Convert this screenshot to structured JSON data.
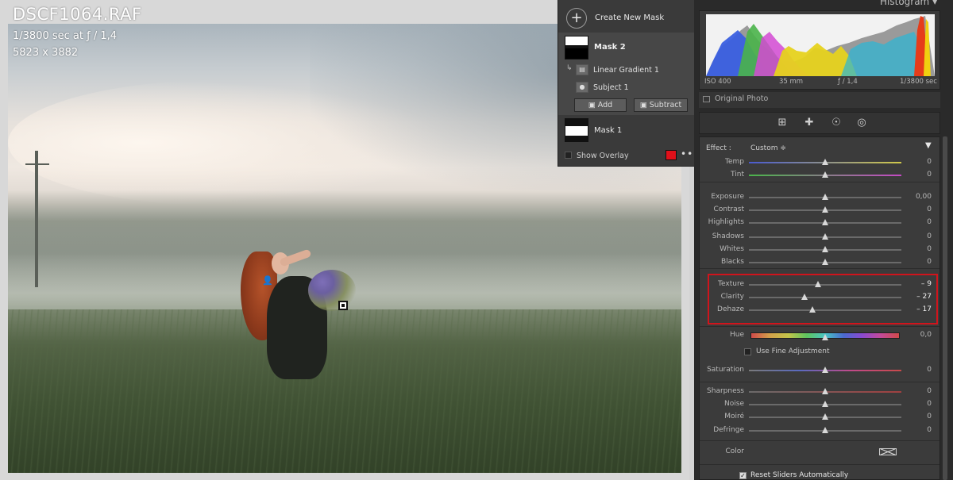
{
  "photo_info": {
    "filename": "DSCF1064.RAF",
    "exposure": "1/3800 sec at ƒ / 1,4",
    "dimensions": "5823 x 3882"
  },
  "mask_panel": {
    "create_label": "Create New Mask",
    "mask2_label": "Mask 2",
    "sub_items": [
      {
        "label": "Linear Gradient 1",
        "icon": "gradient-icon"
      },
      {
        "label": "Subject 1",
        "icon": "person-icon"
      }
    ],
    "add_label": "Add",
    "subtract_label": "Subtract",
    "mask1_label": "Mask 1",
    "show_overlay_label": "Show Overlay",
    "overlay_color": "#e0101a"
  },
  "histogram": {
    "title": "Histogram",
    "iso": "ISO 400",
    "focal": "35 mm",
    "aperture": "ƒ / 1,4",
    "shutter": "1/3800 sec",
    "original_photo_label": "Original Photo"
  },
  "tools": [
    "crop-icon",
    "heal-icon",
    "redeye-icon",
    "masking-icon"
  ],
  "effect": {
    "label": "Effect :",
    "value": "Custom ≑"
  },
  "sliders_group1": [
    {
      "label": "Temp",
      "value": "0",
      "pos": 0.5
    },
    {
      "label": "Tint",
      "value": "0",
      "pos": 0.5
    }
  ],
  "sliders_group2": [
    {
      "label": "Exposure",
      "value": "0,00",
      "pos": 0.5
    },
    {
      "label": "Contrast",
      "value": "0",
      "pos": 0.5
    },
    {
      "label": "Highlights",
      "value": "0",
      "pos": 0.5
    },
    {
      "label": "Shadows",
      "value": "0",
      "pos": 0.5
    },
    {
      "label": "Whites",
      "value": "0",
      "pos": 0.5
    },
    {
      "label": "Blacks",
      "value": "0",
      "pos": 0.5
    }
  ],
  "sliders_group3": [
    {
      "label": "Texture",
      "value": "– 9",
      "pos": 0.455
    },
    {
      "label": "Clarity",
      "value": "– 27",
      "pos": 0.365
    },
    {
      "label": "Dehaze",
      "value": "– 17",
      "pos": 0.415
    }
  ],
  "hue": {
    "label": "Hue",
    "value": "0,0",
    "pos": 0.5
  },
  "fine_adjustment_label": "Use Fine Adjustment",
  "saturation": {
    "label": "Saturation",
    "value": "0",
    "pos": 0.5
  },
  "sliders_group4": [
    {
      "label": "Sharpness",
      "value": "0",
      "pos": 0.5
    },
    {
      "label": "Noise",
      "value": "0",
      "pos": 0.5
    },
    {
      "label": "Moiré",
      "value": "0",
      "pos": 0.5
    },
    {
      "label": "Defringe",
      "value": "0",
      "pos": 0.5
    }
  ],
  "color_label": "Color",
  "reset_label": "Reset Sliders Automatically"
}
